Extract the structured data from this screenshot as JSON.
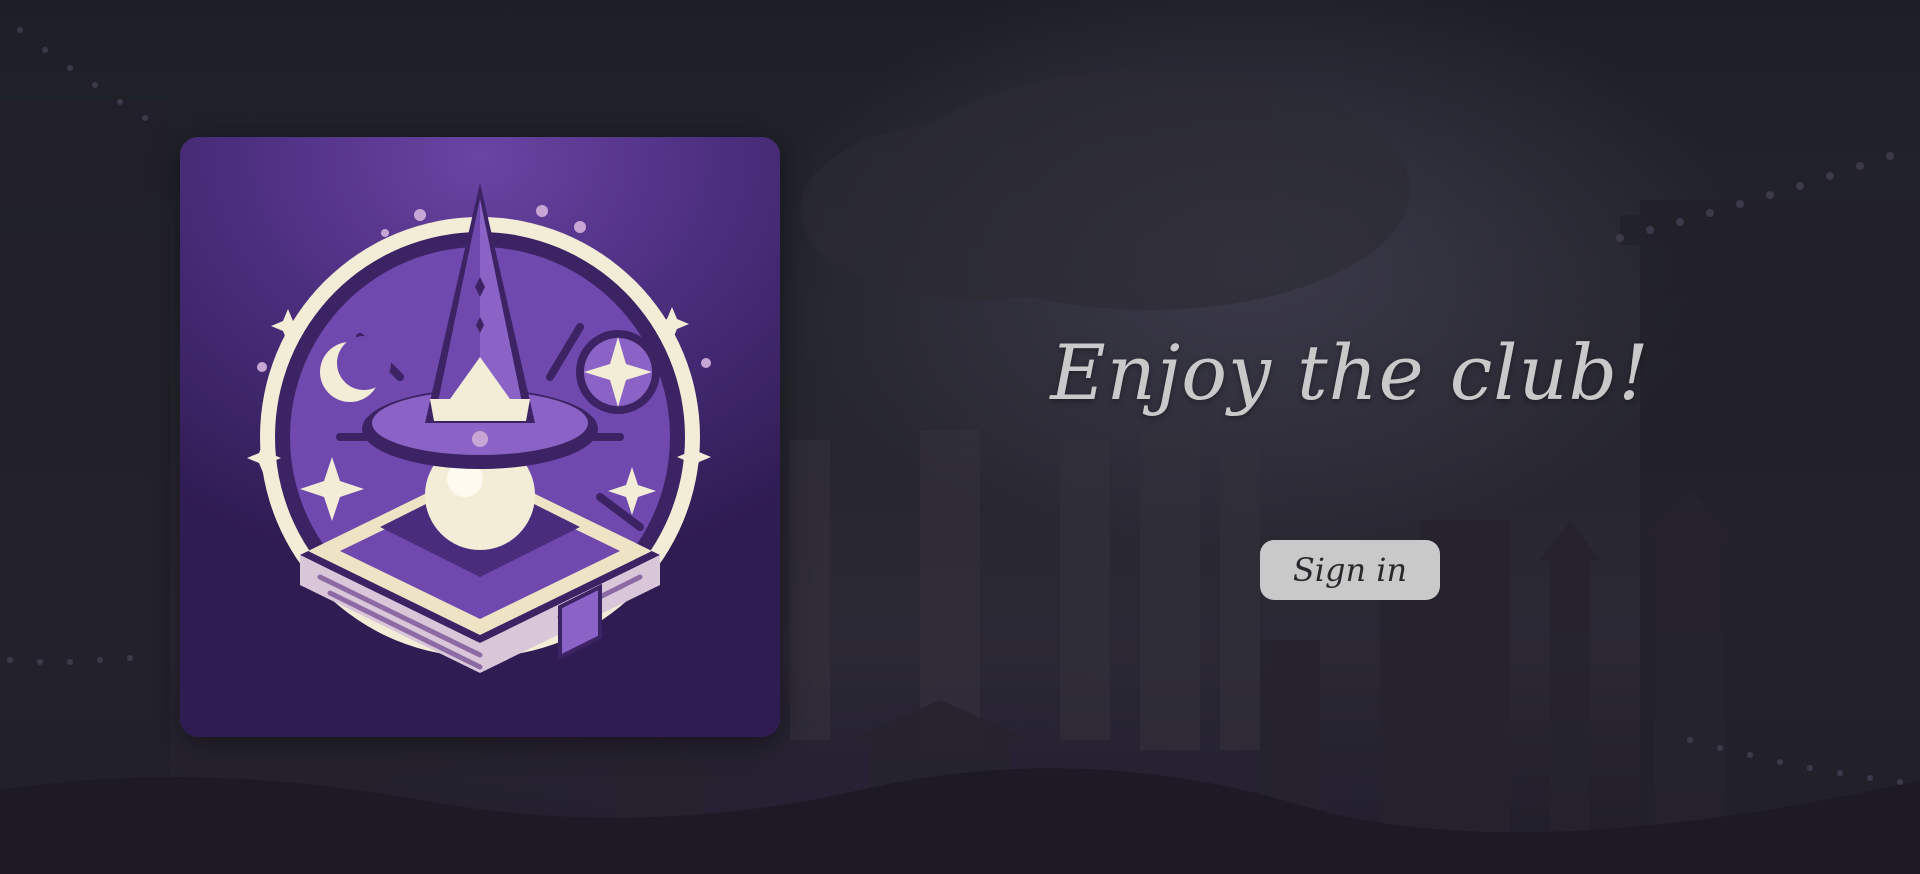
{
  "hero": {
    "headline": "Enjoy the club!",
    "signin_label": "Sign in"
  },
  "logo": {
    "icon": "wizard-hat-crystal-ball-book-icon"
  },
  "colors": {
    "background": "#1e2029",
    "card_purple": "#4d2f80",
    "text": "#c9c9c9",
    "button_bg": "#c9c9c9",
    "cream": "#f3ecd7"
  }
}
